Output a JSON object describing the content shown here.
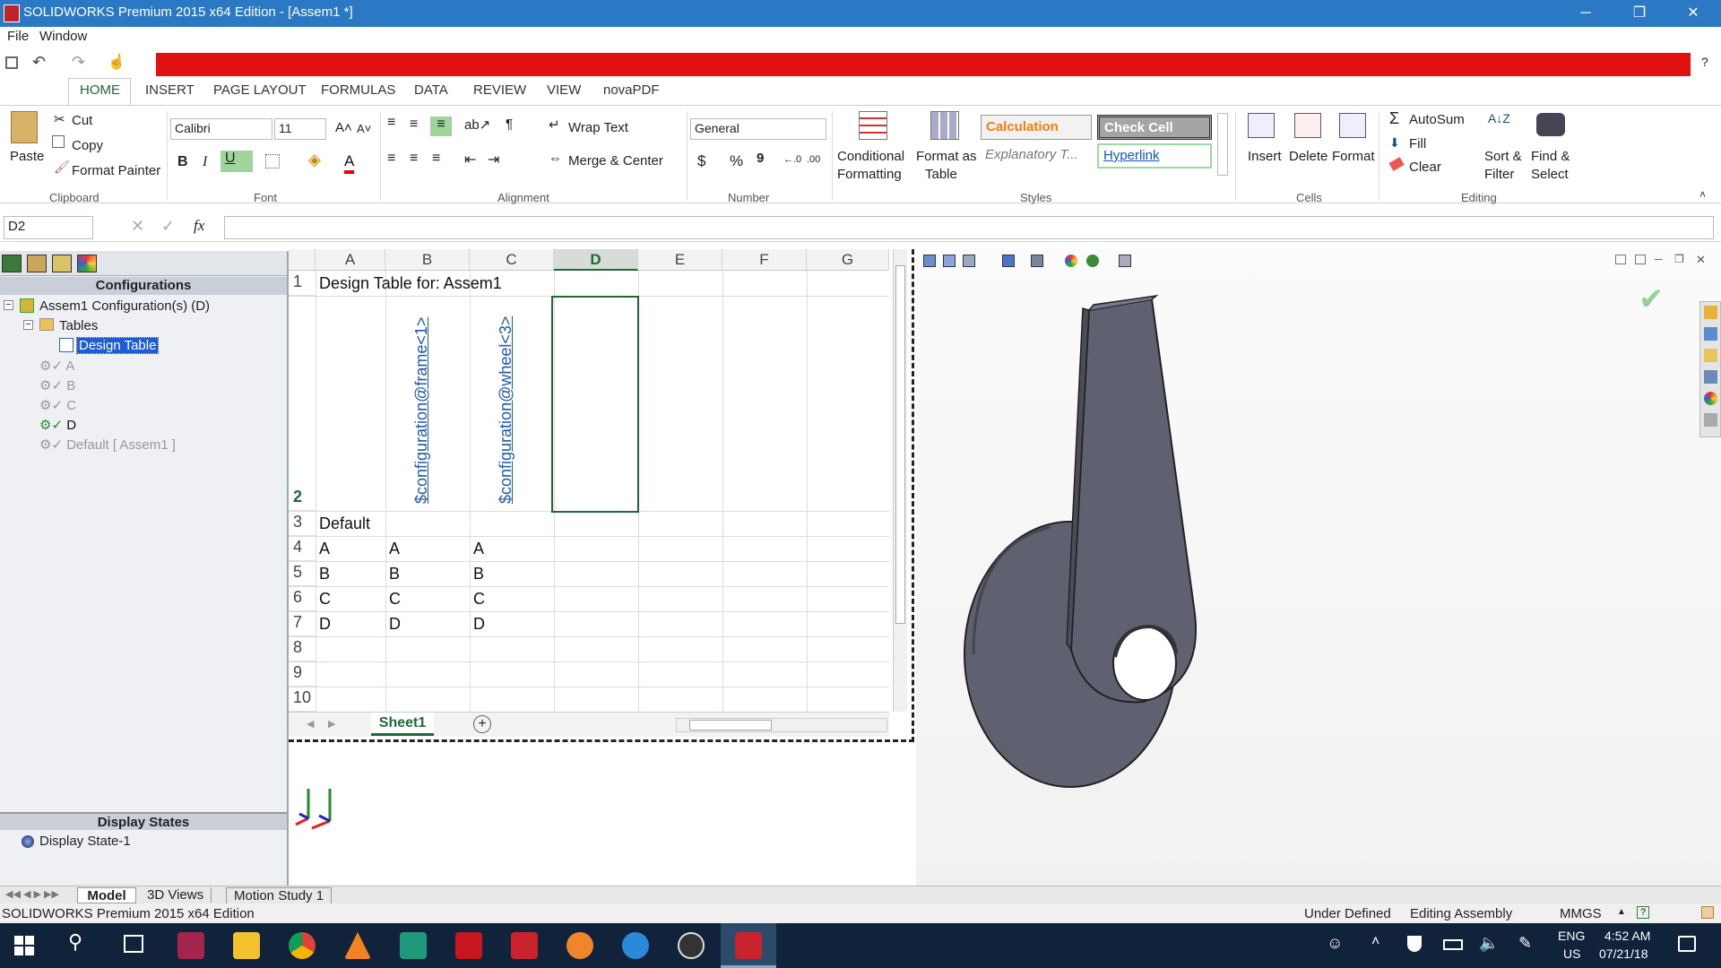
{
  "window": {
    "title": "SOLIDWORKS Premium 2015 x64 Edition - [Assem1 *]",
    "controls": [
      "─",
      "❐",
      "✕"
    ]
  },
  "menu": {
    "items": [
      "File",
      "Window"
    ]
  },
  "ribbon": {
    "tabs": [
      "HOME",
      "INSERT",
      "PAGE LAYOUT",
      "FORMULAS",
      "DATA",
      "REVIEW",
      "VIEW",
      "novaPDF"
    ],
    "clipboard": {
      "paste": "Paste",
      "cut": "Cut",
      "copy": "Copy",
      "format_painter": "Format Painter",
      "group": "Clipboard"
    },
    "font": {
      "name": "Calibri",
      "size": "11",
      "group": "Font",
      "bold": "B",
      "italic": "I",
      "underline": "U"
    },
    "alignment": {
      "wrap": "Wrap Text",
      "merge": "Merge & Center",
      "group": "Alignment"
    },
    "number": {
      "format": "General",
      "group": "Number",
      "currency": "$",
      "percent": "%",
      "comma": "9"
    },
    "styles": {
      "conditional": [
        "Conditional",
        "Formatting"
      ],
      "format_table": [
        "Format as",
        "Table"
      ],
      "calculation": "Calculation",
      "check_cell": "Check Cell",
      "explanatory": "Explanatory T...",
      "hyperlink": "Hyperlink",
      "group": "Styles"
    },
    "cells": {
      "insert": "Insert",
      "delete": "Delete",
      "format": "Format",
      "group": "Cells"
    },
    "editing": {
      "autosum": "AutoSum",
      "fill": "Fill",
      "clear": "Clear",
      "sort": [
        "Sort &",
        "Filter"
      ],
      "find": [
        "Find &",
        "Select"
      ],
      "group": "Editing"
    }
  },
  "formula_bar": {
    "name_box": "D2",
    "fx": "fx",
    "formula": ""
  },
  "config_tree": {
    "header": "Configurations",
    "root": "Assem1 Configuration(s)  (D)",
    "tables": "Tables",
    "design_table": "Design Table",
    "configs": [
      "A",
      "B",
      "C",
      "D",
      "Default [ Assem1 ]"
    ],
    "display_header": "Display States",
    "display_state": "Display State-1"
  },
  "sheet": {
    "columns": [
      "A",
      "B",
      "C",
      "D",
      "E",
      "F",
      "G"
    ],
    "rows": [
      "1",
      "2",
      "3",
      "4",
      "5",
      "6",
      "7",
      "8",
      "9",
      "10"
    ],
    "title_cell": "Design Table for: Assem1",
    "header_b": "$configuration@frame<1>",
    "header_c": "$configuration@wheel<3>",
    "row3_a": "Default",
    "data": [
      [
        "A",
        "A",
        "A"
      ],
      [
        "B",
        "B",
        "B"
      ],
      [
        "C",
        "C",
        "C"
      ],
      [
        "D",
        "D",
        "D"
      ]
    ],
    "tab": "Sheet1"
  },
  "bottom_tabs": [
    "Model",
    "3D Views",
    "Motion Study 1"
  ],
  "status": {
    "left": "SOLIDWORKS Premium 2015 x64 Edition",
    "defined": "Under Defined",
    "mode": "Editing Assembly",
    "units": "MMGS"
  },
  "taskbar": {
    "lang": "ENG",
    "region": "US",
    "time": "4:52 AM",
    "date": "07/21/18"
  },
  "colors": {
    "title": "#2b79c4",
    "taskbar": "#10233a",
    "red_bar": "#e31010",
    "part": "#5f6170"
  }
}
